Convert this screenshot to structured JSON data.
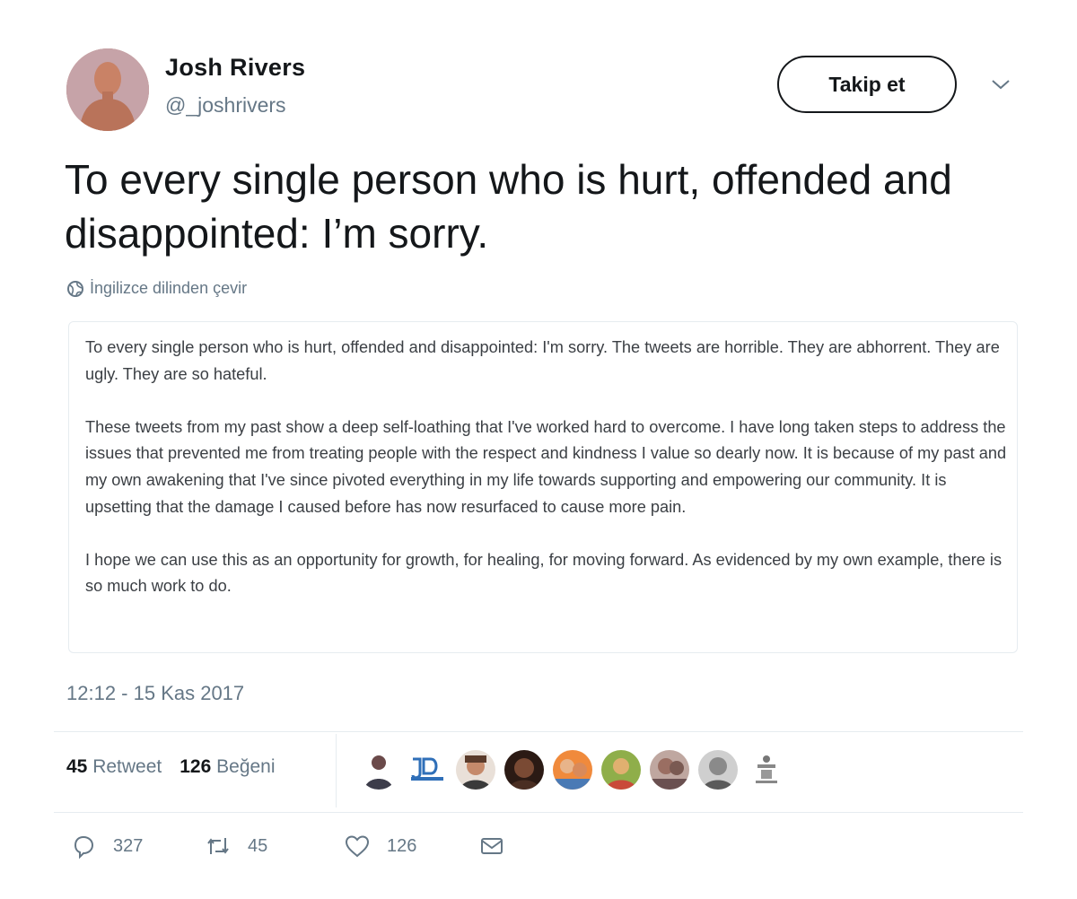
{
  "user": {
    "name": "Josh Rivers",
    "handle": "@_joshrivers"
  },
  "follow_button": "Takip et",
  "tweet": {
    "text": "To every single person who is hurt, offended and disappointed: I’m sorry.",
    "translate_label": "İngilizce dilinden çevir",
    "image_text": {
      "paragraph_1": "To every single person who is hurt, offended and disappointed: I'm sorry. The tweets are horrible. They are abhorrent. They are ugly. They are so hateful.",
      "paragraph_2": "These tweets from my past show a deep self-loathing that I've worked hard to overcome. I have long taken steps to address the issues that prevented me from treating people with the respect and kindness I value so dearly now. It is because of my past and my own awakening that I've since pivoted everything in my life towards supporting and empowering our community. It is upsetting that the damage I caused before has now resurfaced to cause more pain.",
      "paragraph_3": "I hope we can use this as an opportunity for growth, for healing, for moving forward. As evidenced by my own example, there is so much work to do."
    },
    "timestamp": "12:12 - 15 Kas 2017"
  },
  "stats": {
    "retweet_count": "45",
    "retweet_label": "Retweet",
    "like_count": "126",
    "like_label": "Beğeni"
  },
  "actions": {
    "replies": "327",
    "retweets": "45",
    "likes": "126"
  },
  "icons": {
    "translate": "globe-icon",
    "reply": "reply-icon",
    "retweet": "retweet-icon",
    "like": "heart-icon",
    "dm": "envelope-icon",
    "more": "chevron-down-icon"
  },
  "colors": {
    "text": "#14171a",
    "secondary": "#657786",
    "border": "#e6ecf0"
  }
}
